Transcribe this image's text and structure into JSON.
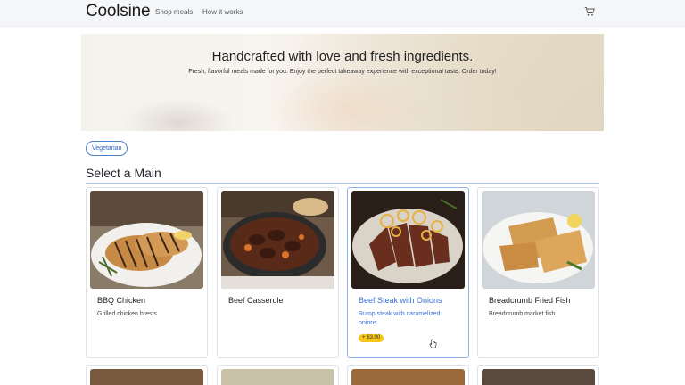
{
  "navbar": {
    "brand": "Coolsine",
    "links": [
      "Shop meals",
      "How it works"
    ],
    "cart_icon": "shopping-cart-icon"
  },
  "hero": {
    "title": "Handcrafted with love and fresh ingredients.",
    "subtitle": "Fresh, flavorful meals made for you. Enjoy the perfect takeaway experience with exceptional taste. Order today!"
  },
  "filters": [
    "Vegetarian"
  ],
  "section": {
    "title": "Select a Main"
  },
  "cards": [
    {
      "title": "BBQ Chicken",
      "description": "Grilled chicken brests"
    },
    {
      "title": "Beef Casserole",
      "description": ""
    },
    {
      "title": "Beef Steak with Onions",
      "description": "Rump steak with caramelized onions",
      "price": "+ $3.00"
    },
    {
      "title": "Breadcrumb Fried Fish",
      "description": "Breadcrumb market fish"
    }
  ],
  "colors": {
    "accent": "#3a6fd0",
    "badge": "#f5c518",
    "rule": "#a9c1ec"
  }
}
